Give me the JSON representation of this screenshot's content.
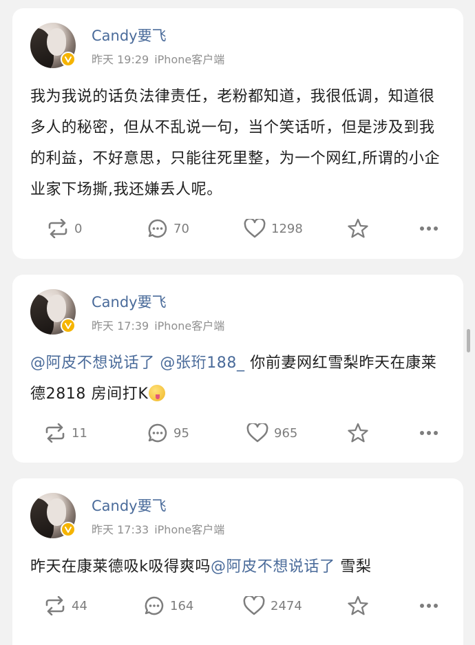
{
  "posts": [
    {
      "author": "Candy要飞",
      "time": "昨天 19:29",
      "source": "iPhone客户端",
      "text_parts": [
        {
          "t": "我为我说的话负法律责任，老粉都知道，我很低调，知道很多人的秘密，但从不乱说一句，当个笑话听，但是涉及到我的利益，不好意思，只能往死里整，为一个网红,所谓的小企业家下场撕,我还嫌丢人呢。"
        }
      ],
      "reposts": "0",
      "comments": "70",
      "likes": "1298"
    },
    {
      "author": "Candy要飞",
      "time": "昨天 17:39",
      "source": "iPhone客户端",
      "text_parts": [
        {
          "t": "@阿皮不想说话了",
          "mention": true
        },
        {
          "t": " "
        },
        {
          "t": "@张珩188_",
          "mention": true
        },
        {
          "t": " 你前妻网红雪梨昨天在康莱德2818 房间打K"
        }
      ],
      "emoji": "tongue-emoji",
      "reposts": "11",
      "comments": "95",
      "likes": "965"
    },
    {
      "author": "Candy要飞",
      "time": "昨天 17:33",
      "source": "iPhone客户端",
      "text_parts": [
        {
          "t": "昨天在康莱德吸k吸得爽吗"
        },
        {
          "t": "@阿皮不想说话了",
          "mention": true
        },
        {
          "t": " 雪梨"
        }
      ],
      "reposts": "44",
      "comments": "164",
      "likes": "2474"
    }
  ],
  "icons": {
    "repost": "repost-icon",
    "comment": "comment-icon",
    "like": "like-icon",
    "favorite": "star-icon",
    "more": "more-icon",
    "verified": "verified-badge-icon"
  },
  "colors": {
    "name": "#4a6b9a",
    "mention": "#4a6b9a",
    "meta": "#8f8f8f",
    "text": "#1f1f1f",
    "icon": "#7d7d7d",
    "badge": "#f5b400"
  }
}
